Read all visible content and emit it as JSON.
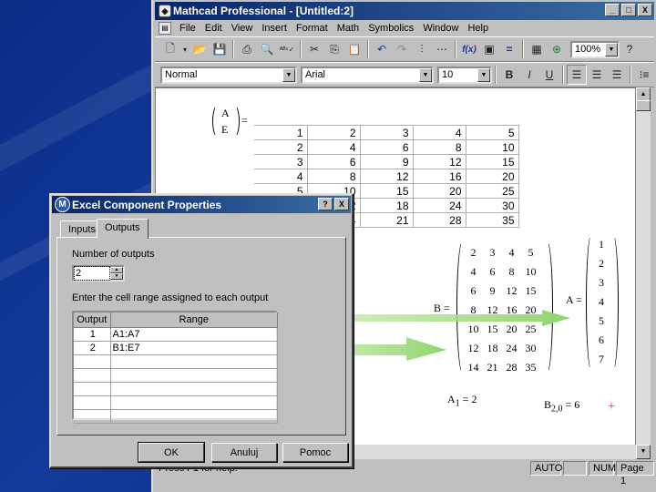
{
  "window": {
    "title": "Mathcad Professional - [Untitled:2]",
    "minimize": "_",
    "restore": "□",
    "close": "X"
  },
  "menu": [
    "File",
    "Edit",
    "View",
    "Insert",
    "Format",
    "Math",
    "Symbolics",
    "Window",
    "Help"
  ],
  "toolbar": {
    "zoom": "100%",
    "style": "Normal",
    "font": "Arial",
    "size": "10",
    "bold": "B",
    "italic": "I",
    "underline": "U"
  },
  "worksheet": {
    "assignment_left_top": "A",
    "assignment_left_bottom": "E",
    "equals": "=",
    "excel_rows": [
      [
        "1",
        "2",
        "3",
        "4",
        "5"
      ],
      [
        "2",
        "4",
        "6",
        "8",
        "10"
      ],
      [
        "3",
        "6",
        "9",
        "12",
        "15"
      ],
      [
        "4",
        "8",
        "12",
        "16",
        "20"
      ],
      [
        "5",
        "10",
        "15",
        "20",
        "25"
      ],
      [
        "6",
        "12",
        "18",
        "24",
        "30"
      ],
      [
        "7",
        "14",
        "21",
        "28",
        "35"
      ]
    ],
    "b_label": "B =",
    "matrix_b": [
      [
        "2",
        "3",
        "4",
        "5"
      ],
      [
        "4",
        "6",
        "8",
        "10"
      ],
      [
        "6",
        "9",
        "12",
        "15"
      ],
      [
        "8",
        "12",
        "16",
        "20"
      ],
      [
        "10",
        "15",
        "20",
        "25"
      ],
      [
        "12",
        "18",
        "24",
        "30"
      ],
      [
        "14",
        "21",
        "28",
        "35"
      ]
    ],
    "a_label": "A =",
    "matrix_a": [
      "1",
      "2",
      "3",
      "4",
      "5",
      "6",
      "7"
    ],
    "a1_base": "A",
    "a1_sub": "1",
    "a1_rest": "= 2",
    "b2_base": "B",
    "b2_sub": "2,0",
    "b2_rest": "= 6",
    "cursor": "+"
  },
  "status": {
    "help_text": "Press F1 for help.",
    "auto": "AUTO",
    "num": "NUM",
    "page": "Page 1"
  },
  "dialog": {
    "title": "Excel Component Properties",
    "help_btn": "?",
    "close_btn": "X",
    "icon": "M",
    "tab_inputs": "Inputs",
    "tab_outputs": "Outputs",
    "num_outputs_label": "Number of outputs",
    "num_outputs_value": "2",
    "range_label": "Enter the cell range assigned to each output",
    "col_output": "Output",
    "col_range": "Range",
    "rows": [
      {
        "output": "1",
        "range": "A1:A7"
      },
      {
        "output": "2",
        "range": "B1:E7"
      }
    ],
    "ok": "OK",
    "cancel": "Anuluj",
    "help": "Pomoc"
  },
  "colors": {
    "desktop": "#0b2d86",
    "titlebar": "#08246b",
    "arrow": "#8fd46a"
  }
}
